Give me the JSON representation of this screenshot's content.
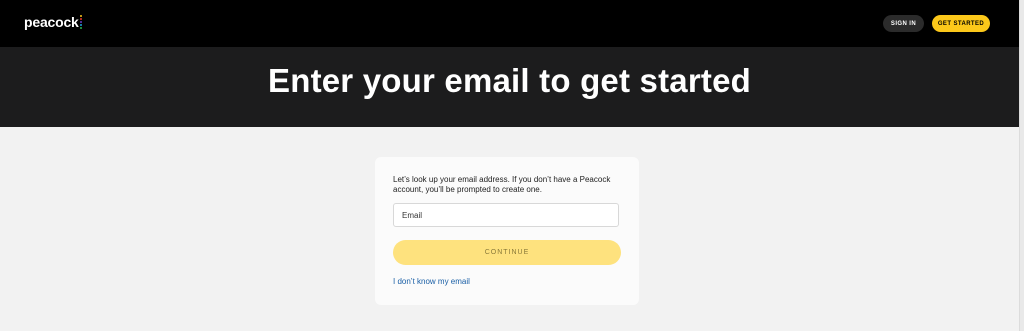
{
  "header": {
    "logo_text": "peacock",
    "logo_dot_colors": [
      "#fcc81a",
      "#e4362b",
      "#6a3cc7",
      "#1fa0e0",
      "#2db34a",
      "#e4362b"
    ],
    "signin_label": "SIGN IN",
    "getstarted_label": "GET STARTED"
  },
  "hero": {
    "title": "Enter your email to get started"
  },
  "form": {
    "intro": "Let’s look up your email address. If you don’t have a Peacock account, you’ll be prompted to create one.",
    "email_placeholder": "Email",
    "continue_label": "CONTINUE",
    "forgot_link": "I don’t know my email"
  },
  "colors": {
    "accent": "#fcc81a",
    "continue_disabled": "#fee27e",
    "link": "#1a5fa6"
  }
}
